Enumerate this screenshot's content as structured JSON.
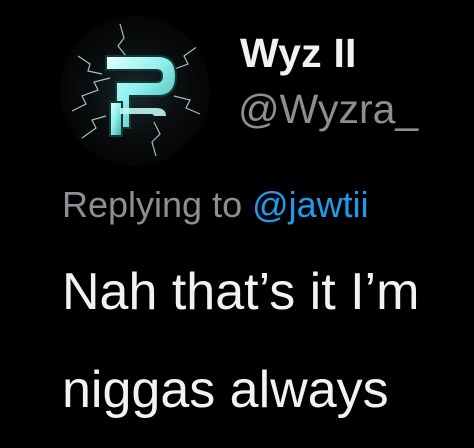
{
  "author": {
    "display_name": "Wyz II",
    "handle": "@Wyzra_",
    "avatar_icon": "lightning-p-logo-icon"
  },
  "reply": {
    "prefix": "Replying to ",
    "mention": "@jawtii"
  },
  "tweet": {
    "lines": [
      "Nah that’s it I’m",
      "niggas always"
    ]
  },
  "colors": {
    "background": "#000000",
    "display_name": "#f2f2f2",
    "secondary_text": "#8b8f94",
    "mention_blue": "#1d9bf0",
    "body_text": "#f2f2f2",
    "logo_accent": "#7ff2f2"
  }
}
